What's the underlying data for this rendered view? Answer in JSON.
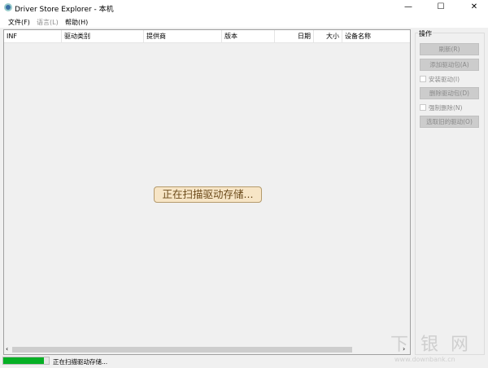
{
  "window": {
    "title": "Driver Store Explorer - 本机",
    "minimize": "—",
    "maximize": "☐",
    "close": "✕"
  },
  "menu": [
    {
      "label": "文件(F)",
      "enabled": true
    },
    {
      "label": "语言(L)",
      "enabled": false
    },
    {
      "label": "帮助(H)",
      "enabled": true
    }
  ],
  "columns": [
    "INF",
    "驱动类别",
    "提供商",
    "版本",
    "日期",
    "大小",
    "设备名称"
  ],
  "list": {
    "scanning_label": "正在扫描驱动存储..."
  },
  "actions": {
    "group_label": "操作",
    "refresh": "刷新(R)",
    "add": "添加驱动包(A)",
    "install": "安装驱动(I)",
    "delete": "删除驱动包(D)",
    "force_delete": "强制删除(N)",
    "select_old": "选取旧的驱动(O)"
  },
  "status": {
    "text": "正在扫描驱动存储...",
    "progress_percent": 90,
    "progress_color": "#06b025"
  },
  "watermark": {
    "text": "下 银 网",
    "url_text": "www.downbank.cn"
  }
}
